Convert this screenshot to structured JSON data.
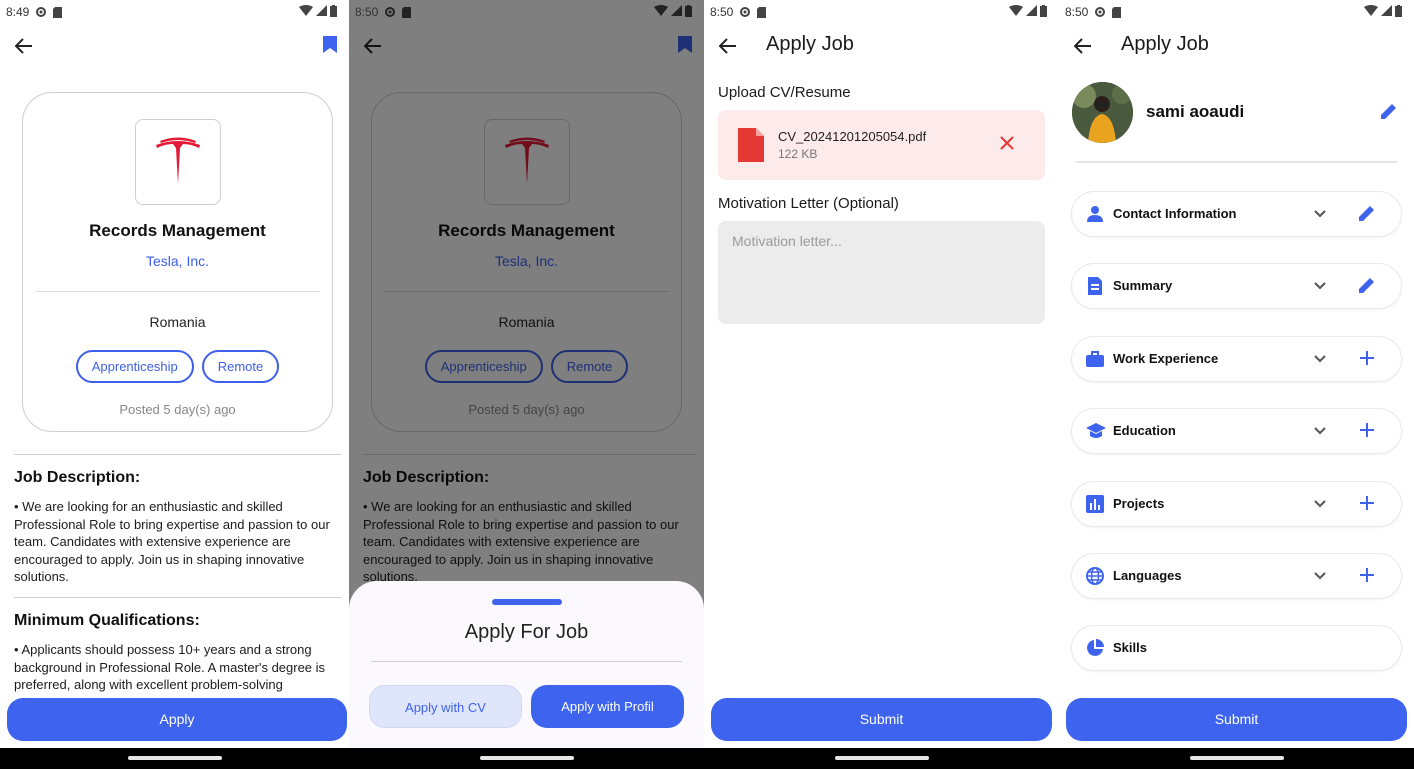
{
  "colors": {
    "accent": "#3d63ef",
    "danger": "#e53935",
    "card_border": "#cfcfcf"
  },
  "screen1": {
    "status_time": "8:49",
    "job": {
      "title": "Records Management",
      "company": "Tesla, Inc.",
      "location": "Romania",
      "tags": [
        "Apprenticeship",
        "Remote"
      ],
      "posted": "Posted 5 day(s) ago"
    },
    "job_description_heading": "Job Description:",
    "job_description_text": "• We are looking for an enthusiastic and skilled Professional Role to bring expertise and passion to our team. Candidates with extensive experience are encouraged to apply. Join us in shaping innovative solutions.",
    "min_qual_heading": "Minimum Qualifications:",
    "min_qual_text": "• Applicants should possess 10+ years and a strong background in Professional Role. A master's degree is preferred, along with excellent problem-solving",
    "apply_label": "Apply"
  },
  "screen2": {
    "status_time": "8:50",
    "sheet_title": "Apply For Job",
    "apply_cv_label": "Apply with CV",
    "apply_profile_label": "Apply with Profil"
  },
  "screen3": {
    "status_time": "8:50",
    "title": "Apply Job",
    "upload_label": "Upload CV/Resume",
    "file_name": "CV_20241201205054.pdf",
    "file_size": "122 KB",
    "motivation_label": "Motivation Letter (Optional)",
    "motivation_placeholder": "Motivation letter...",
    "submit_label": "Submit"
  },
  "screen4": {
    "status_time": "8:50",
    "title": "Apply Job",
    "profile_name": "sami aoaudi",
    "sections": [
      {
        "label": "Contact Information",
        "icon": "person-icon",
        "action": "edit-icon"
      },
      {
        "label": "Summary",
        "icon": "summary-icon",
        "action": "edit-icon"
      },
      {
        "label": "Work Experience",
        "icon": "briefcase-icon",
        "action": "add-icon"
      },
      {
        "label": "Education",
        "icon": "school-icon",
        "action": "add-icon"
      },
      {
        "label": "Projects",
        "icon": "bar-chart-icon",
        "action": "add-icon"
      },
      {
        "label": "Languages",
        "icon": "globe-icon",
        "action": "add-icon"
      },
      {
        "label": "Skills",
        "icon": "pie-chart-icon",
        "action": "none"
      }
    ],
    "submit_label": "Submit"
  }
}
